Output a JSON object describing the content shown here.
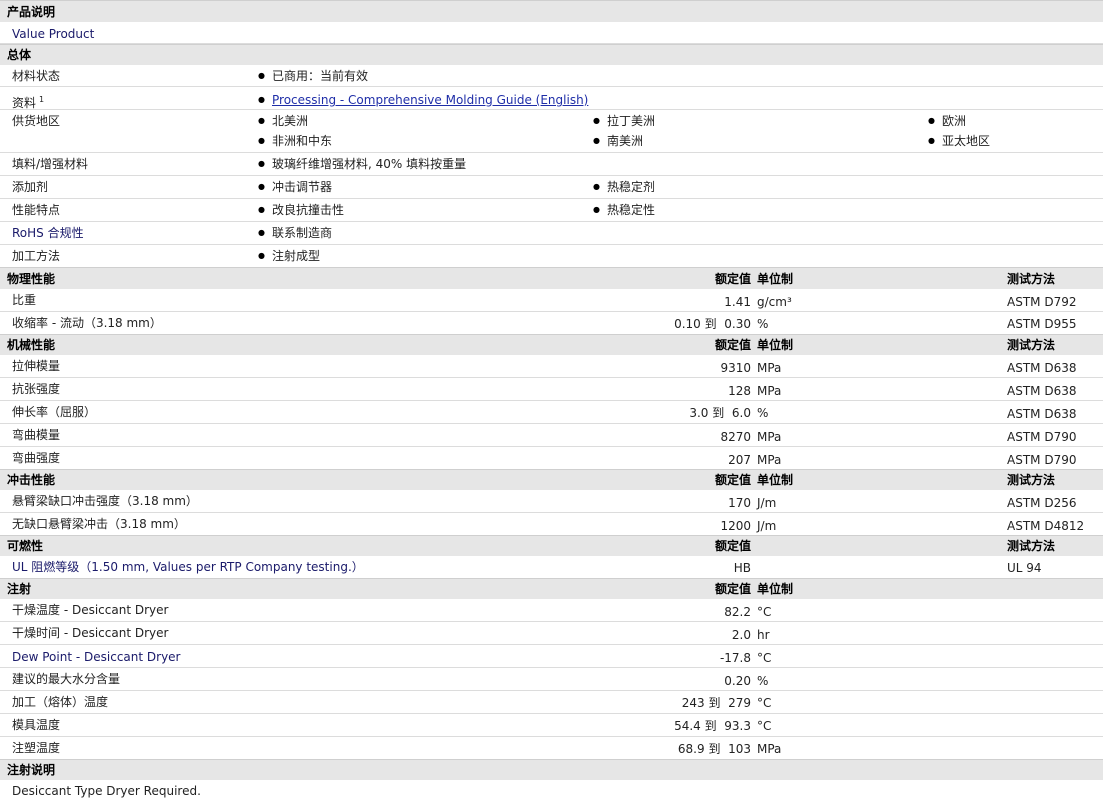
{
  "sections": {
    "description": {
      "title": "产品说明",
      "text": "Value Product"
    },
    "general": {
      "title": "总体",
      "material_status": {
        "label": "材料状态",
        "value": "已商用：当前有效"
      },
      "literature": {
        "label": "资料",
        "sup": "1",
        "link": "Processing - Comprehensive Molding Guide (English)"
      },
      "availability": {
        "label": "供货地区",
        "items": [
          "北美洲",
          "拉丁美洲",
          "欧洲",
          "非洲和中东",
          "南美洲",
          "亚太地区"
        ]
      },
      "filler": {
        "label": "填料/增强材料",
        "value": "玻璃纤维增强材料, 40% 填料按重量"
      },
      "additive": {
        "label": "添加剂",
        "items": [
          "冲击调节器",
          "热稳定剂"
        ]
      },
      "features": {
        "label": "性能特点",
        "items": [
          "改良抗撞击性",
          "热稳定性"
        ]
      },
      "rohs": {
        "label": "RoHS 合规性",
        "value": "联系制造商"
      },
      "processing": {
        "label": "加工方法",
        "value": "注射成型"
      }
    },
    "physical": {
      "title": "物理性能",
      "nominal": "额定值",
      "unit": "单位制",
      "method": "测试方法",
      "rows": [
        {
          "label": "比重",
          "value": "1.41",
          "unit": "g/cm³",
          "method": "ASTM D792"
        },
        {
          "label": "收缩率 - 流动（3.18 mm）",
          "value_from": "0.10",
          "to": "到",
          "value": "0.30",
          "unit": "%",
          "method": "ASTM D955"
        }
      ]
    },
    "mechanical": {
      "title": "机械性能",
      "nominal": "额定值",
      "unit": "单位制",
      "method": "测试方法",
      "rows": [
        {
          "label": "拉伸模量",
          "value": "9310",
          "unit": "MPa",
          "method": "ASTM D638"
        },
        {
          "label": "抗张强度",
          "value": "128",
          "unit": "MPa",
          "method": "ASTM D638"
        },
        {
          "label": "伸长率（屈服）",
          "value_from": "3.0",
          "to": "到",
          "value": "6.0",
          "unit": "%",
          "method": "ASTM D638"
        },
        {
          "label": "弯曲模量",
          "value": "8270",
          "unit": "MPa",
          "method": "ASTM D790"
        },
        {
          "label": "弯曲强度",
          "value": "207",
          "unit": "MPa",
          "method": "ASTM D790"
        }
      ]
    },
    "impact": {
      "title": "冲击性能",
      "nominal": "额定值",
      "unit": "单位制",
      "method": "测试方法",
      "rows": [
        {
          "label": "悬臂梁缺口冲击强度（3.18 mm）",
          "value": "170",
          "unit": "J/m",
          "method": "ASTM D256"
        },
        {
          "label": "无缺口悬臂梁冲击（3.18 mm）",
          "value": "1200",
          "unit": "J/m",
          "method": "ASTM D4812"
        }
      ]
    },
    "flammability": {
      "title": "可燃性",
      "nominal": "额定值",
      "method": "测试方法",
      "rows": [
        {
          "label": "UL 阻燃等级（1.50 mm, Values per RTP Company testing.）",
          "value": "HB",
          "method": "UL 94"
        }
      ]
    },
    "injection": {
      "title": "注射",
      "nominal": "额定值",
      "unit": "单位制",
      "rows": [
        {
          "label": "干燥温度 - Desiccant Dryer",
          "value": "82.2",
          "unit": "°C"
        },
        {
          "label": "干燥时间 - Desiccant Dryer",
          "value": "2.0",
          "unit": "hr"
        },
        {
          "label": "Dew Point - Desiccant Dryer",
          "value": "-17.8",
          "unit": "°C"
        },
        {
          "label": "建议的最大水分含量",
          "value": "0.20",
          "unit": "%"
        },
        {
          "label": "加工（熔体）温度",
          "value_from": "243",
          "to": "到",
          "value": "279",
          "unit": "°C"
        },
        {
          "label": "模具温度",
          "value_from": "54.4",
          "to": "到",
          "value": "93.3",
          "unit": "°C"
        },
        {
          "label": "注塑温度",
          "value_from": "68.9",
          "to": "到",
          "value": "103",
          "unit": "MPa"
        }
      ]
    },
    "notes": {
      "title": "注射说明",
      "text": "Desiccant Type Dryer Required."
    }
  }
}
